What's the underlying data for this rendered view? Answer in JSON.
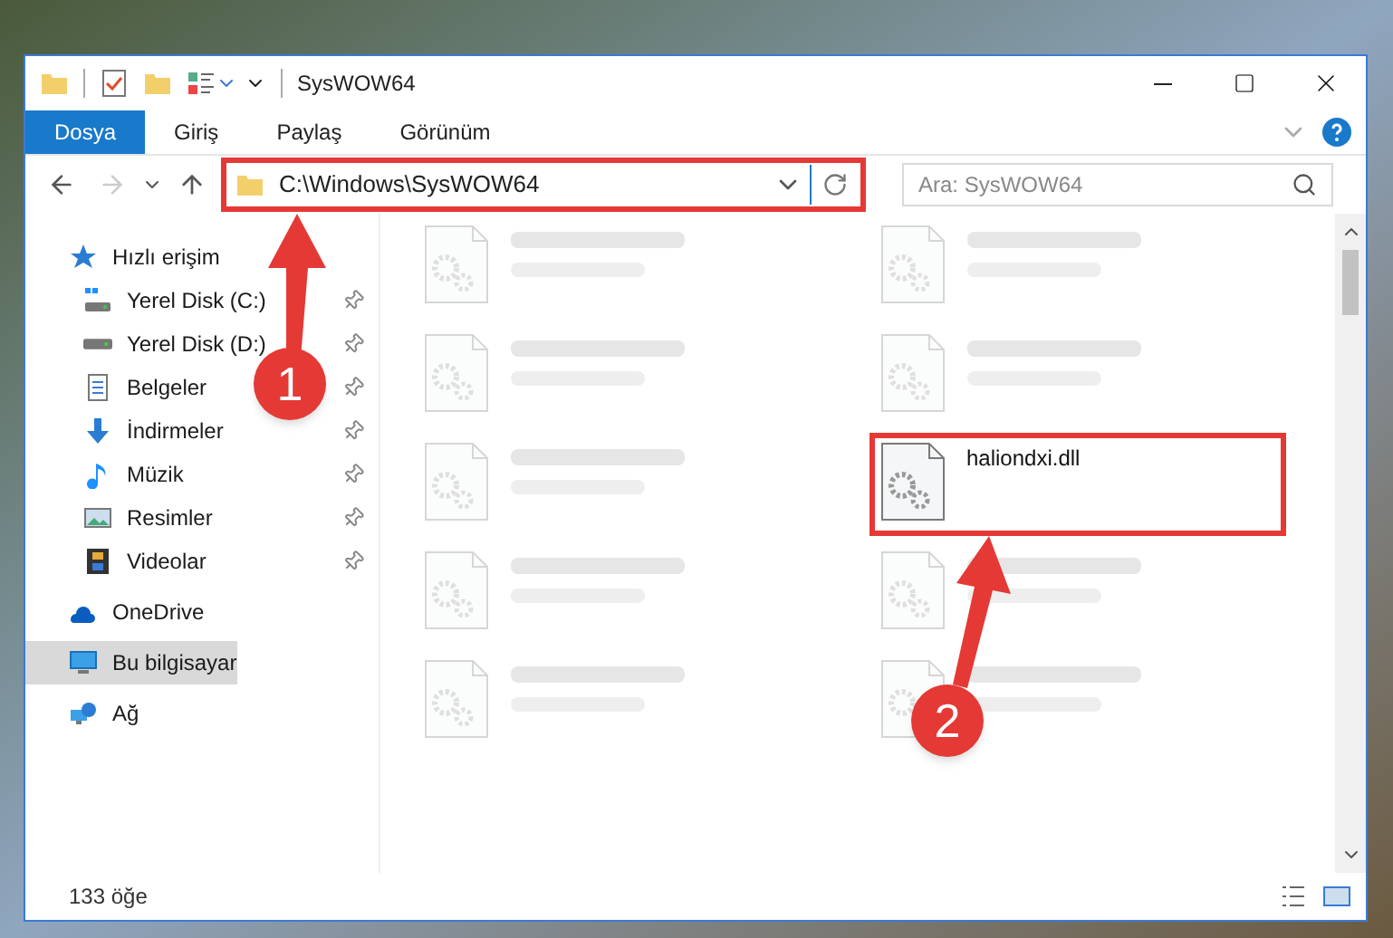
{
  "window": {
    "title": "SysWOW64"
  },
  "ribbon_tabs": [
    {
      "label": "Dosya",
      "selected": true
    },
    {
      "label": "Giriş",
      "selected": false
    },
    {
      "label": "Paylaş",
      "selected": false
    },
    {
      "label": "Görünüm",
      "selected": false
    }
  ],
  "address_bar": {
    "path": "C:\\Windows\\SysWOW64"
  },
  "search": {
    "placeholder": "Ara: SysWOW64"
  },
  "sidebar": {
    "items": [
      {
        "label": "Hızlı erişim",
        "kind": "star",
        "selected": false,
        "children": [
          {
            "label": "Yerel Disk (C:)",
            "kind": "drive-win",
            "selected": false,
            "pinned": true
          },
          {
            "label": "Yerel Disk (D:)",
            "kind": "drive",
            "selected": false,
            "pinned": true
          },
          {
            "label": "Belgeler",
            "kind": "doc",
            "selected": false,
            "pinned": true
          },
          {
            "label": "İndirmeler",
            "kind": "download",
            "selected": false,
            "pinned": true
          },
          {
            "label": "Müzik",
            "kind": "music",
            "selected": false,
            "pinned": true
          },
          {
            "label": "Resimler",
            "kind": "picture",
            "selected": false,
            "pinned": true
          },
          {
            "label": "Videolar",
            "kind": "video",
            "selected": false,
            "pinned": true
          }
        ]
      },
      {
        "label": "OneDrive",
        "kind": "cloud",
        "selected": false
      },
      {
        "label": "Bu bilgisayar",
        "kind": "pc",
        "selected": true
      },
      {
        "label": "Ağ",
        "kind": "network",
        "selected": false
      }
    ]
  },
  "files": [
    {
      "blurred": true,
      "highlighted": false
    },
    {
      "blurred": true,
      "highlighted": false
    },
    {
      "blurred": true,
      "highlighted": false
    },
    {
      "blurred": true,
      "highlighted": false
    },
    {
      "blurred": true,
      "highlighted": false
    },
    {
      "name": "haliondxi.dll",
      "blurred": false,
      "highlighted": true
    },
    {
      "blurred": true,
      "highlighted": false
    },
    {
      "blurred": true,
      "highlighted": false
    },
    {
      "blurred": true,
      "highlighted": false
    },
    {
      "blurred": true,
      "highlighted": false
    }
  ],
  "status_bar": {
    "count": "133 öğe"
  },
  "annotations": [
    {
      "number": "1"
    },
    {
      "number": "2"
    }
  ]
}
